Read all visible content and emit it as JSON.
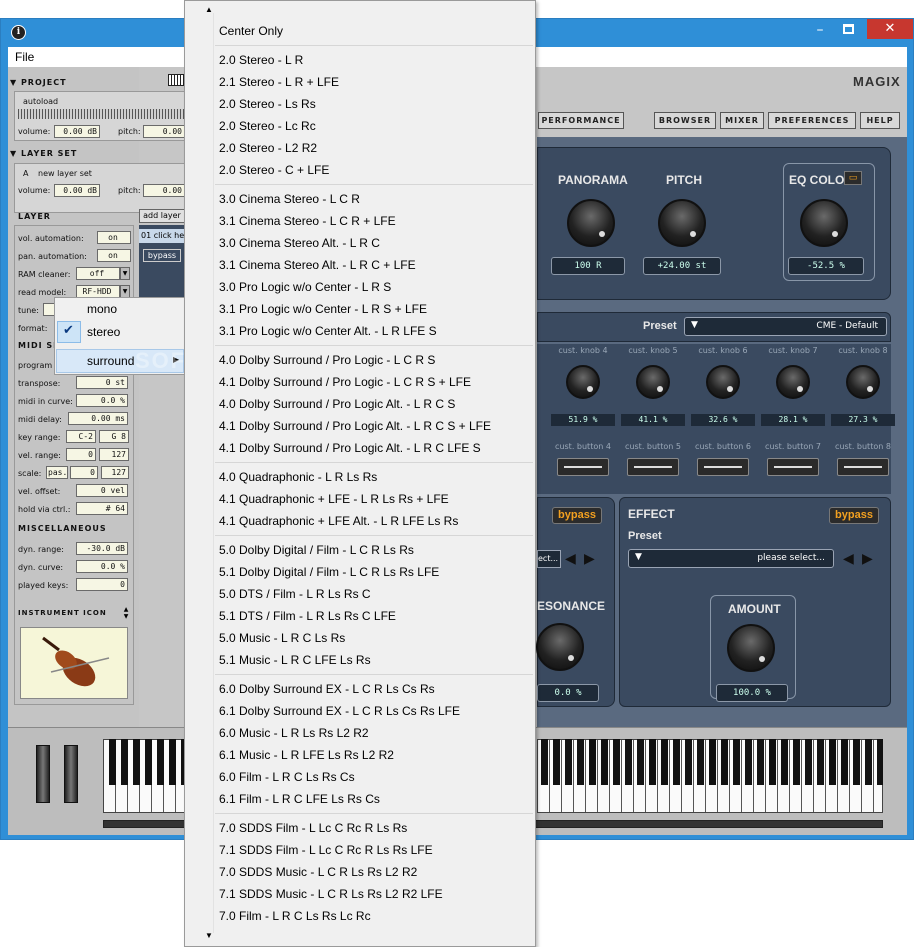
{
  "app": {
    "title_icon": "info-icon",
    "window_controls": [
      "minimize-icon",
      "maximize-icon",
      "close-icon"
    ]
  },
  "menu_bar": {
    "file": "File"
  },
  "brand": "MAGIX",
  "nav_buttons": [
    "PERFORMANCE",
    "BROWSER",
    "MIXER",
    "PREFERENCES",
    "HELP"
  ],
  "project": {
    "header": "PROJECT",
    "name": "autoload",
    "volume_label": "volume:",
    "volume": "0.00 dB",
    "pitch_label": "pitch:",
    "pitch": "0.00"
  },
  "layer_set": {
    "header": "LAYER SET",
    "item_letter": "A",
    "item": "new layer set",
    "volume_label": "volume:",
    "volume": "0.00 dB",
    "pitch_label": "pitch:",
    "pitch": "0.00"
  },
  "layer": {
    "header": "LAYER",
    "add_layer": "add layer",
    "list_item": "01  click he",
    "bypass": "bypass",
    "vol_automation_label": "vol. automation:",
    "vol_automation": "on",
    "pan_automation_label": "pan. automation:",
    "pan_automation": "on",
    "ram_cleaner_label": "RAM cleaner:",
    "ram_cleaner": "off",
    "read_model_label": "read model:",
    "read_model": "RF-HDD",
    "tune_label": "tune:",
    "format_label": "format:"
  },
  "midi": {
    "header": "MIDI SE",
    "program_label": "program",
    "transpose_label": "transpose:",
    "transpose": "0 st",
    "midi_in_curve_label": "midi in curve:",
    "midi_in_curve": "0.0 %",
    "midi_delay_label": "midi delay:",
    "midi_delay": "0.00 ms",
    "key_range_label": "key range:",
    "key_range_lo": "C-2",
    "key_range_hi": "G 8",
    "vel_range_label": "vel. range:",
    "vel_range_lo": "0",
    "vel_range_hi": "127",
    "scale_label": "scale:",
    "scale_mode": "pas.",
    "scale_lo": "0",
    "scale_hi": "127",
    "vel_offset_label": "vel. offset:",
    "vel_offset": "0 vel",
    "hold_label": "hold via ctrl.:",
    "hold": "# 64"
  },
  "misc": {
    "header": "MISCELLANEOUS",
    "dyn_range_label": "dyn. range:",
    "dyn_range": "-30.0 dB",
    "dyn_curve_label": "dyn. curve:",
    "dyn_curve": "0.0 %",
    "played_keys_label": "played keys:",
    "played_keys": "0"
  },
  "instrument_icon": {
    "header": "INSTRUMENT ICON",
    "image": "violin-icon"
  },
  "knobs_top": {
    "panorama_label": "PANORAMA",
    "panorama": "100 R",
    "pitch_label": "PITCH",
    "pitch": "+24.00 st",
    "eq_label": "EQ COLOR",
    "eq": "-52.5 %"
  },
  "preset_bar": {
    "label": "Preset",
    "value": "CME - Default"
  },
  "cust_knobs": [
    {
      "label": "cust. knob 4",
      "value": "51.9 %"
    },
    {
      "label": "cust. knob 5",
      "value": "41.1 %"
    },
    {
      "label": "cust. knob 6",
      "value": "32.6 %"
    },
    {
      "label": "cust. knob 7",
      "value": "28.1 %"
    },
    {
      "label": "cust. knob 8",
      "value": "27.3 %"
    }
  ],
  "cust_buttons": [
    "cust. button 4",
    "cust. button 5",
    "cust. button 6",
    "cust. button 7",
    "cust. button 8"
  ],
  "filter": {
    "bypass": "bypass",
    "preset_value": "ect...",
    "resonance_label": "ESONANCE",
    "resonance": "0.0 %"
  },
  "effect": {
    "header": "EFFECT",
    "bypass": "bypass",
    "preset_label": "Preset",
    "preset_value": "please select...",
    "amount_label": "AMOUNT",
    "amount": "100.0 %"
  },
  "format_submenu": {
    "items": [
      "mono",
      "stereo",
      "surround"
    ],
    "checked": "stereo"
  },
  "watermark": "SOFTPEDIA",
  "surround_menu": {
    "groups": [
      [
        "Center Only"
      ],
      [
        "2.0 Stereo - L R",
        "2.1 Stereo - L R + LFE",
        "2.0 Stereo - Ls Rs",
        "2.0 Stereo - Lc Rc",
        "2.0 Stereo - L2 R2",
        "2.0 Stereo - C + LFE"
      ],
      [
        "3.0 Cinema Stereo - L C R",
        "3.1 Cinema Stereo - L C R + LFE",
        "3.0 Cinema Stereo Alt. - L R C",
        "3.1 Cinema Stereo Alt. - L R C + LFE",
        "3.0 Pro Logic w/o Center - L R S",
        "3.1 Pro Logic w/o Center - L R S + LFE",
        "3.1 Pro Logic w/o Center Alt. - L R LFE S"
      ],
      [
        "4.0 Dolby Surround / Pro Logic - L C R S",
        "4.1 Dolby Surround / Pro Logic - L C R S + LFE",
        "4.0 Dolby Surround / Pro Logic Alt. - L R C S",
        "4.1 Dolby Surround / Pro Logic Alt. - L R C S + LFE",
        "4.1 Dolby Surround / Pro Logic Alt. - L R C LFE S"
      ],
      [
        "4.0 Quadraphonic - L R Ls Rs",
        "4.1 Quadraphonic + LFE - L R Ls Rs + LFE",
        "4.1 Quadraphonic + LFE Alt. - L R LFE Ls Rs"
      ],
      [
        "5.0 Dolby Digital / Film - L C R Ls Rs",
        "5.1 Dolby Digital / Film - L C R Ls Rs LFE",
        "5.0 DTS / Film - L R Ls Rs C",
        "5.1 DTS / Film - L R Ls Rs C LFE",
        "5.0 Music - L R C Ls Rs",
        "5.1 Music - L R C LFE Ls Rs"
      ],
      [
        "6.0 Dolby Surround EX - L C R Ls Cs Rs",
        "6.1 Dolby Surround EX - L C R Ls Cs Rs LFE",
        "6.0 Music - L R Ls Rs L2 R2",
        "6.1 Music - L R LFE Ls Rs L2 R2",
        "6.0 Film - L R C Ls Rs Cs",
        "6.1 Film - L R C LFE Ls Rs Cs"
      ],
      [
        "7.0 SDDS Film - L Lc C Rc R Ls Rs",
        "7.1 SDDS Film - L Lc C Rc R Ls Rs LFE",
        "7.0 SDDS Music - L C R Ls Rs L2 R2",
        "7.1 SDDS Music - L C R Ls Rs L2 R2 LFE",
        "7.0 Film - L R C Ls Rs Lc Rc"
      ]
    ]
  }
}
